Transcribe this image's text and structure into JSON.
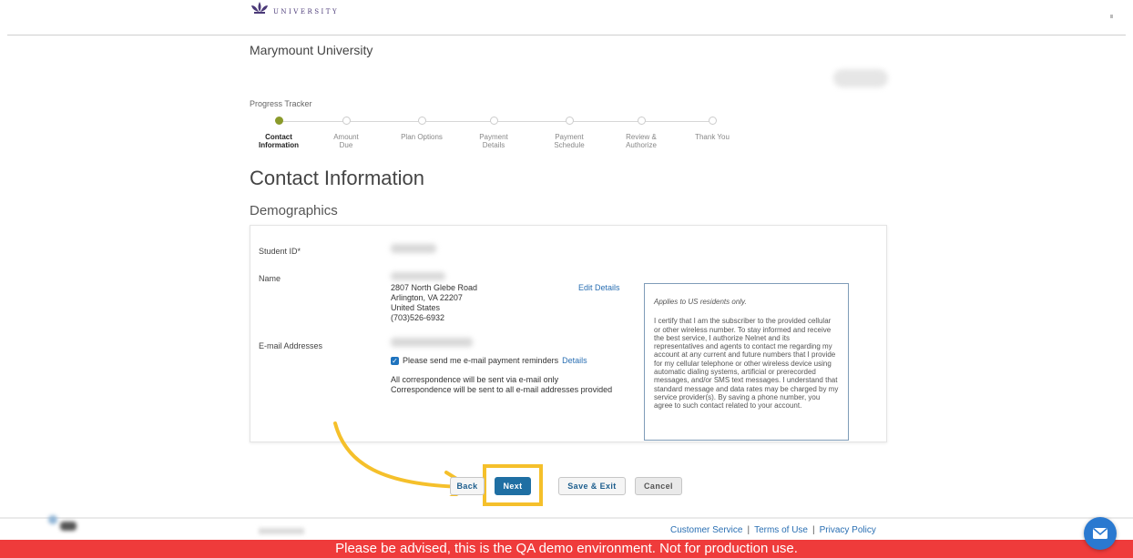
{
  "logo": {
    "sub": "UNIVERSITY"
  },
  "header": {
    "title": "Marymount University"
  },
  "progress": {
    "label": "Progress Tracker",
    "steps": [
      {
        "label": "Contact\nInformation",
        "active": true
      },
      {
        "label": "Amount\nDue",
        "active": false
      },
      {
        "label": "Plan Options",
        "active": false
      },
      {
        "label": "Payment\nDetails",
        "active": false
      },
      {
        "label": "Payment\nSchedule",
        "active": false
      },
      {
        "label": "Review &\nAuthorize",
        "active": false
      },
      {
        "label": "Thank You",
        "active": false
      }
    ]
  },
  "page": {
    "heading": "Contact Information",
    "section": "Demographics"
  },
  "form": {
    "student_id_label": "Student ID*",
    "name_label": "Name",
    "address_line1": "2807 North Glebe Road",
    "address_line2": "Arlington, VA 22207",
    "address_line3": "United States",
    "phone": "(703)526-6932",
    "edit_details": "Edit Details",
    "email_label": "E-mail Addresses",
    "reminder_text": "Please send me e-mail payment reminders",
    "reminder_checked": true,
    "details_link": "Details",
    "corr_line1": "All correspondence will be sent via e-mail only",
    "corr_line2": "Correspondence will be sent to all e-mail addresses provided"
  },
  "consent": {
    "title": "Applies to US residents only.",
    "body": "I certify that I am the subscriber to the provided cellular or other wireless number. To stay informed and receive the best service, I authorize Nelnet and its representatives and agents to contact me regarding my account at any current and future numbers that I provide for my cellular telephone or other wireless device using automatic dialing systems, artificial or prerecorded messages, and/or SMS text messages. I understand that standard message and data rates may be charged by my service provider(s). By saving a phone number, you agree to such contact related to your account."
  },
  "buttons": {
    "back": "Back",
    "next": "Next",
    "save_exit": "Save & Exit",
    "cancel": "Cancel"
  },
  "footer": {
    "customer_service": "Customer Service",
    "terms": "Terms of Use",
    "privacy": "Privacy Policy",
    "sep": "|"
  },
  "banner": {
    "text": "Please be advised, this is the QA demo environment. Not for production use."
  },
  "colors": {
    "accent": "#1f6fa3",
    "progress_active": "#8a9a2b",
    "highlight": "#f5c02b",
    "banner": "#ef3b3b"
  },
  "icons": {
    "chat": "chat-mail-icon",
    "logo": "fleur-de-lis-icon"
  }
}
